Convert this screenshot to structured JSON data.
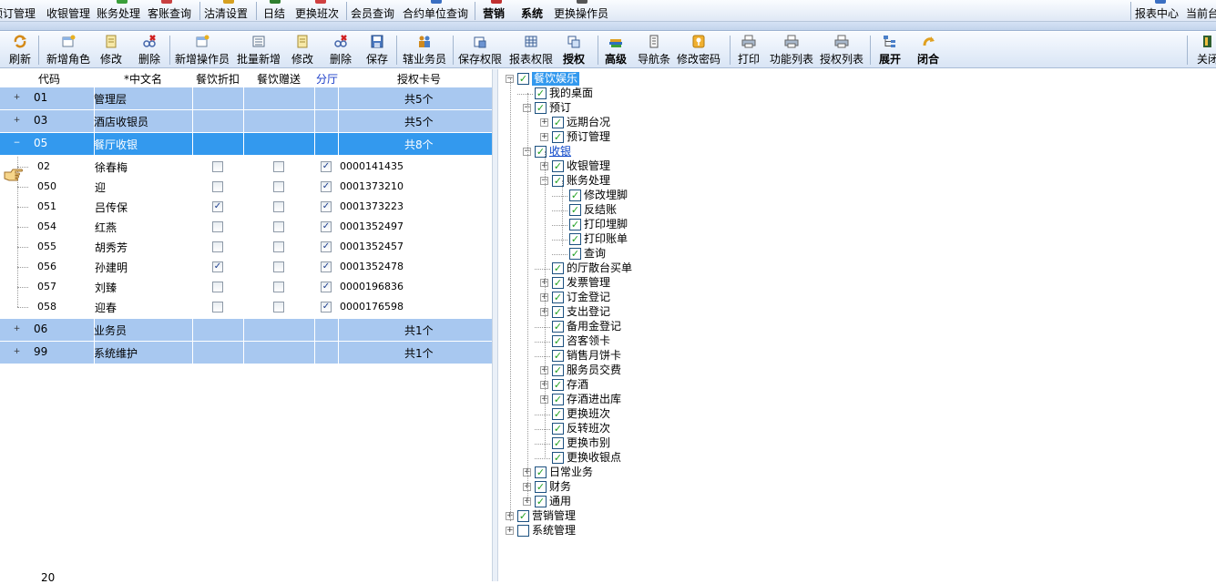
{
  "top_menu": {
    "items": [
      "预订管理",
      "收银管理",
      "账务处理",
      "客账查询",
      "沽清设置",
      "日结",
      "更换班次",
      "会员查询",
      "合约单位查询",
      "营销",
      "系统",
      "更换操作员"
    ],
    "right_items": [
      "报表中心",
      "当前台"
    ]
  },
  "toolbar": {
    "buttons": [
      "刷新",
      "新增角色",
      "修改",
      "删除",
      "新增操作员",
      "批量新增",
      "修改",
      "删除",
      "保存",
      "辖业务员",
      "保存权限",
      "报表权限",
      "授权",
      "高级",
      "导航条",
      "修改密码",
      "打印",
      "功能列表",
      "授权列表",
      "展开",
      "闭合",
      "关闭"
    ],
    "search_value": ""
  },
  "grid": {
    "headers": [
      "代码",
      "*中文名",
      "餐饮折扣",
      "餐饮赠送",
      "分厅",
      "授权卡号"
    ],
    "groups": [
      {
        "code": "01",
        "name": "管理层",
        "count": "共5个",
        "expand": "+"
      },
      {
        "code": "03",
        "name": "酒店收银员",
        "count": "共5个",
        "expand": "+"
      },
      {
        "code": "05",
        "name": "餐厅收银",
        "count": "共8个",
        "expand": "−"
      },
      {
        "code": "06",
        "name": "业务员",
        "count": "共1个",
        "expand": "+"
      },
      {
        "code": "99",
        "name": "系统维护",
        "count": "共1个",
        "expand": "+"
      }
    ],
    "rows": [
      {
        "code": "02",
        "name": "徐春梅",
        "discount": false,
        "gift": false,
        "hall": true,
        "card": "0000141435"
      },
      {
        "code": "050",
        "name": "迎",
        "discount": false,
        "gift": false,
        "hall": true,
        "card": "0001373210"
      },
      {
        "code": "051",
        "name": "吕传保",
        "discount": true,
        "gift": false,
        "hall": true,
        "card": "0001373223"
      },
      {
        "code": "054",
        "name": "红燕",
        "discount": false,
        "gift": false,
        "hall": true,
        "card": "0001352497"
      },
      {
        "code": "055",
        "name": "胡秀芳",
        "discount": false,
        "gift": false,
        "hall": true,
        "card": "0001352457"
      },
      {
        "code": "056",
        "name": "孙建明",
        "discount": true,
        "gift": false,
        "hall": true,
        "card": "0001352478"
      },
      {
        "code": "057",
        "name": "刘臻",
        "discount": false,
        "gift": false,
        "hall": true,
        "card": "0000196836"
      },
      {
        "code": "058",
        "name": "迎春",
        "discount": false,
        "gift": false,
        "hall": true,
        "card": "0000176598"
      }
    ],
    "footer_number": "20"
  },
  "tree": [
    {
      "label": "餐饮娱乐",
      "level": 0,
      "expand": "−",
      "checked": true,
      "style": "hl"
    },
    {
      "label": "我的桌面",
      "level": 1,
      "expand": "",
      "checked": true,
      "style": ""
    },
    {
      "label": "预订",
      "level": 1,
      "expand": "−",
      "checked": true,
      "style": ""
    },
    {
      "label": "远期台况",
      "level": 2,
      "expand": "+",
      "checked": true,
      "style": ""
    },
    {
      "label": "预订管理",
      "level": 2,
      "expand": "+",
      "checked": true,
      "style": ""
    },
    {
      "label": "收银",
      "level": 1,
      "expand": "−",
      "checked": true,
      "style": "link"
    },
    {
      "label": "收银管理",
      "level": 2,
      "expand": "+",
      "checked": true,
      "style": ""
    },
    {
      "label": "账务处理",
      "level": 2,
      "expand": "−",
      "checked": true,
      "style": ""
    },
    {
      "label": "修改埋脚",
      "level": 3,
      "expand": "",
      "checked": true,
      "style": ""
    },
    {
      "label": "反结账",
      "level": 3,
      "expand": "",
      "checked": true,
      "style": ""
    },
    {
      "label": "打印埋脚",
      "level": 3,
      "expand": "",
      "checked": true,
      "style": ""
    },
    {
      "label": "打印账单",
      "level": 3,
      "expand": "",
      "checked": true,
      "style": ""
    },
    {
      "label": "查询",
      "level": 3,
      "expand": "",
      "checked": true,
      "style": ""
    },
    {
      "label": "的厅散台买单",
      "level": 2,
      "expand": "",
      "checked": true,
      "style": ""
    },
    {
      "label": "发票管理",
      "level": 2,
      "expand": "+",
      "checked": true,
      "style": ""
    },
    {
      "label": "订金登记",
      "level": 2,
      "expand": "+",
      "checked": true,
      "style": ""
    },
    {
      "label": "支出登记",
      "level": 2,
      "expand": "+",
      "checked": true,
      "style": ""
    },
    {
      "label": "备用金登记",
      "level": 2,
      "expand": "",
      "checked": true,
      "style": ""
    },
    {
      "label": "咨客领卡",
      "level": 2,
      "expand": "",
      "checked": true,
      "style": ""
    },
    {
      "label": "销售月饼卡",
      "level": 2,
      "expand": "",
      "checked": true,
      "style": ""
    },
    {
      "label": "服务员交费",
      "level": 2,
      "expand": "+",
      "checked": true,
      "style": ""
    },
    {
      "label": "存酒",
      "level": 2,
      "expand": "+",
      "checked": true,
      "style": ""
    },
    {
      "label": "存酒进出库",
      "level": 2,
      "expand": "+",
      "checked": true,
      "style": ""
    },
    {
      "label": "更换班次",
      "level": 2,
      "expand": "",
      "checked": true,
      "style": ""
    },
    {
      "label": "反转班次",
      "level": 2,
      "expand": "",
      "checked": true,
      "style": ""
    },
    {
      "label": "更换市别",
      "level": 2,
      "expand": "",
      "checked": true,
      "style": ""
    },
    {
      "label": "更换收银点",
      "level": 2,
      "expand": "",
      "checked": true,
      "style": ""
    },
    {
      "label": "日常业务",
      "level": 1,
      "expand": "+",
      "checked": true,
      "style": ""
    },
    {
      "label": "财务",
      "level": 1,
      "expand": "+",
      "checked": true,
      "style": ""
    },
    {
      "label": "通用",
      "level": 1,
      "expand": "+",
      "checked": true,
      "style": ""
    },
    {
      "label": "营销管理",
      "level": 0,
      "expand": "+",
      "checked": true,
      "style": ""
    },
    {
      "label": "系统管理",
      "level": 0,
      "expand": "+",
      "checked": false,
      "style": ""
    }
  ],
  "colors": {
    "row_group": "#a8c8f0",
    "row_selected": "#3399ee",
    "check": "#21a121"
  }
}
